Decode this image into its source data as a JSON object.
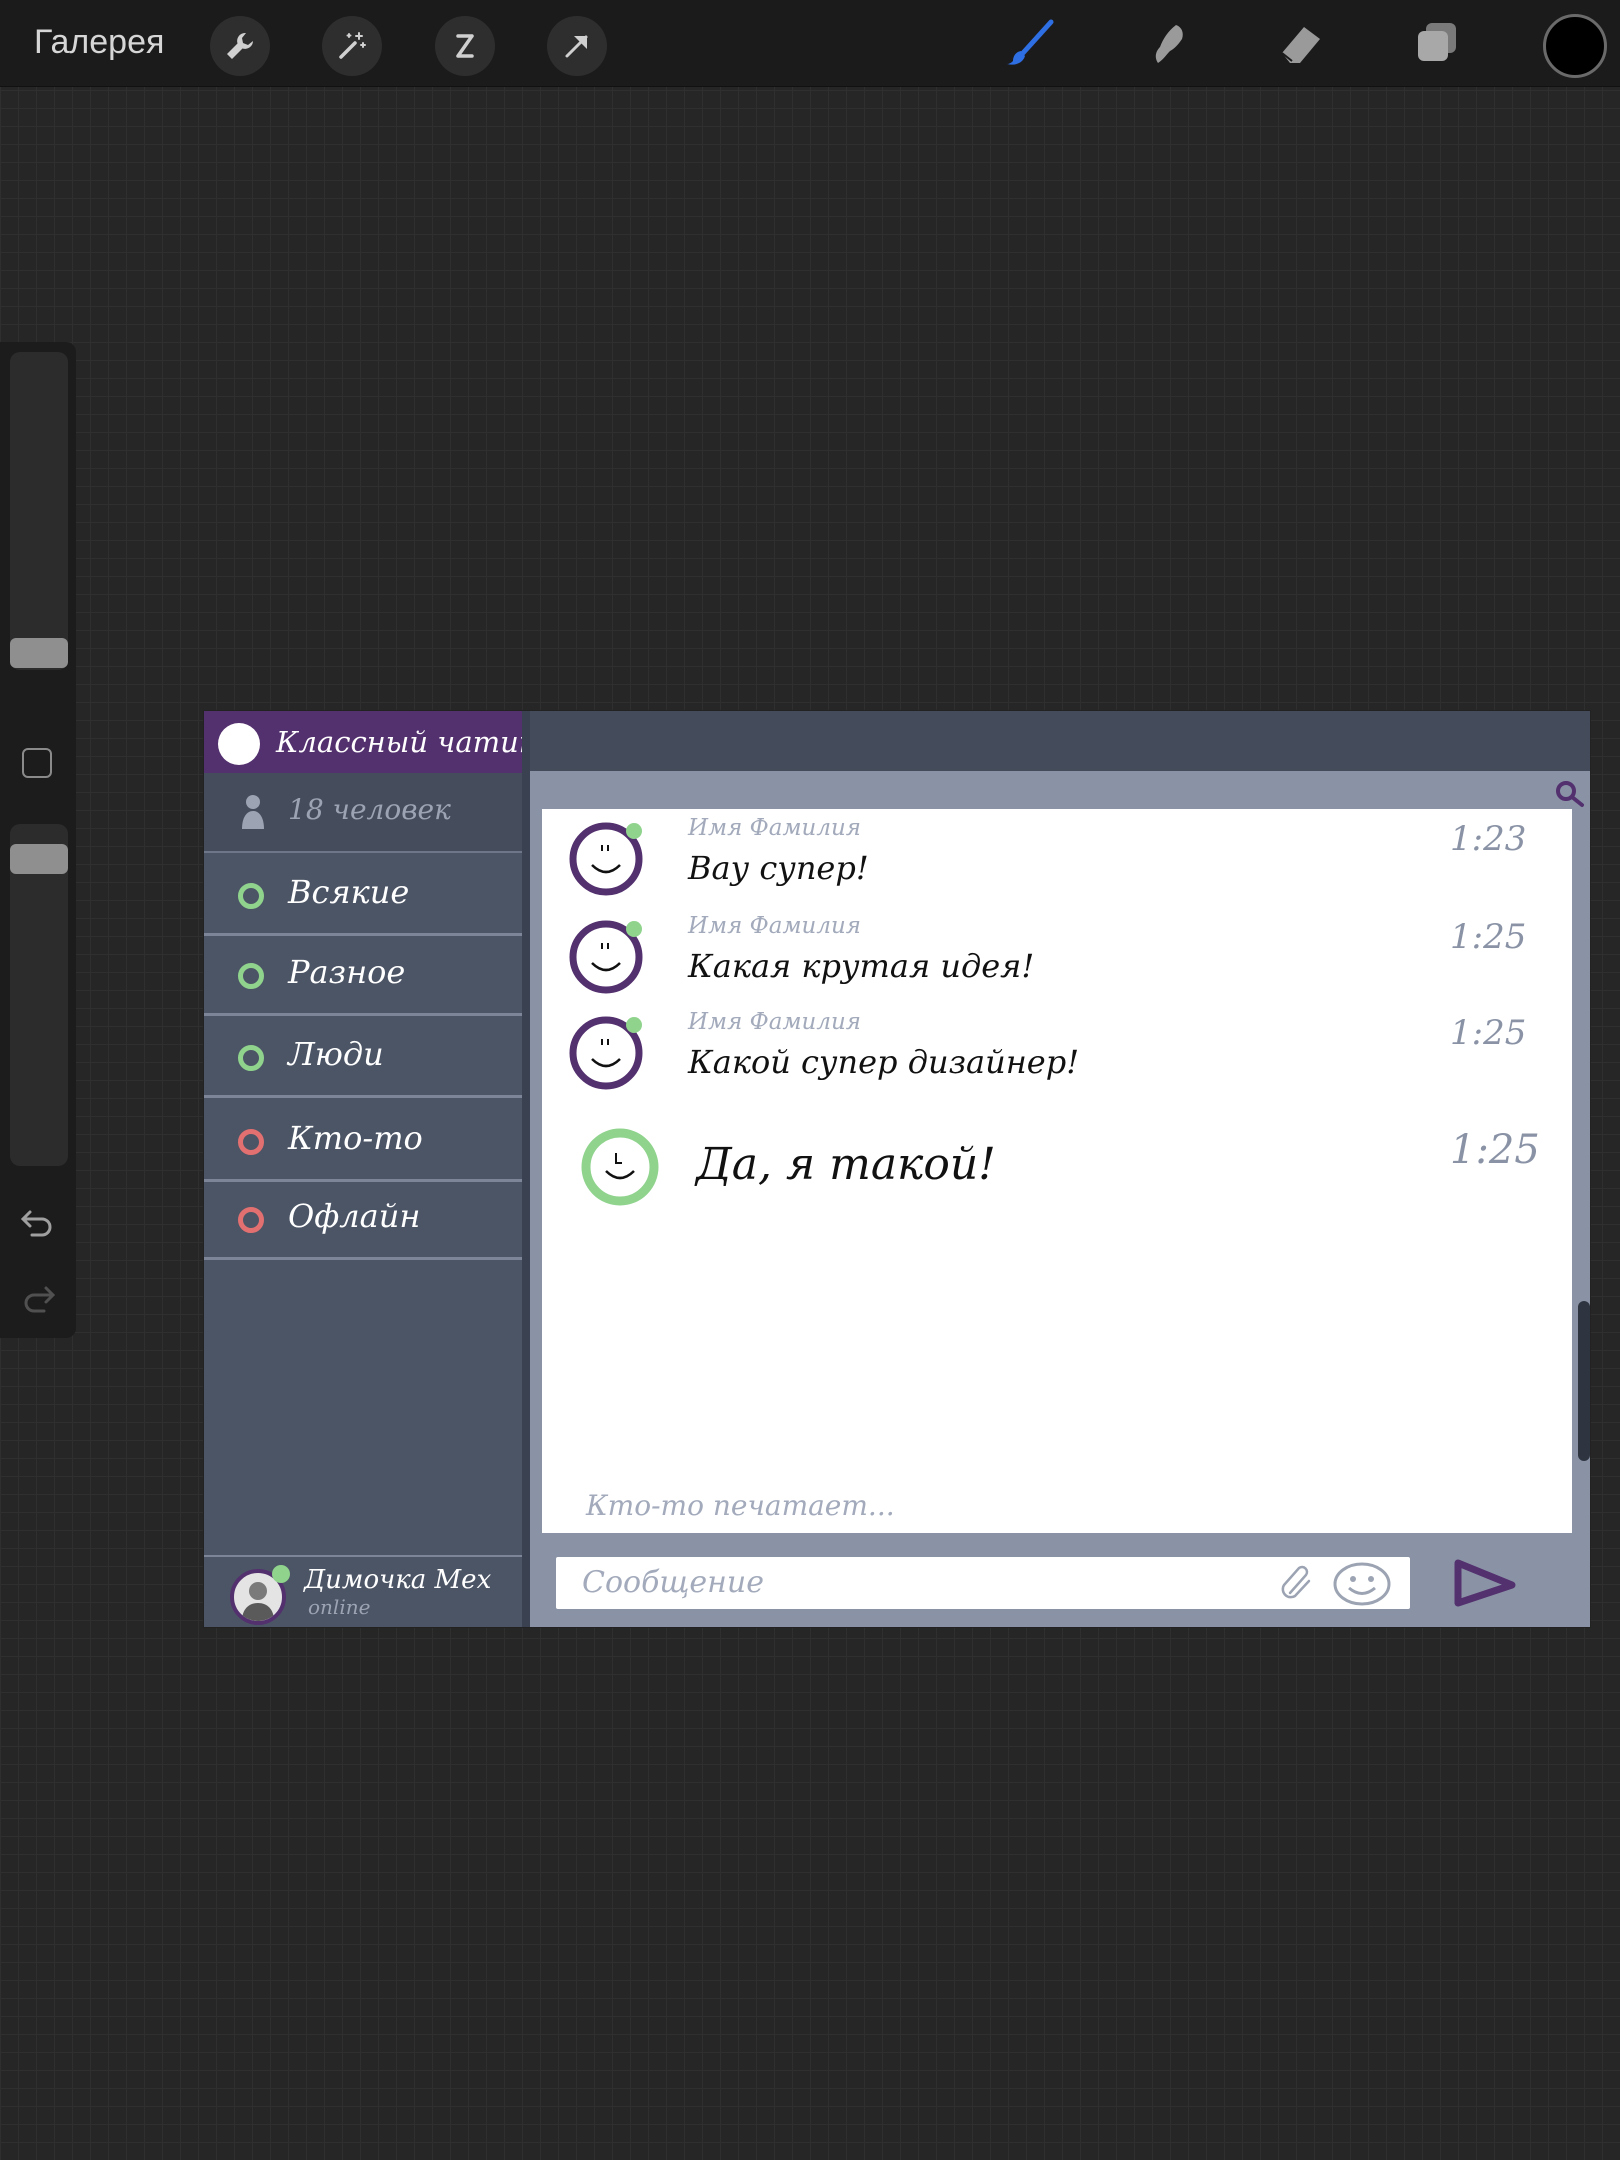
{
  "topbar": {
    "gallery_label": "Галерея",
    "left_tools": [
      "wrench-icon",
      "magic-wand-icon",
      "selection-icon",
      "transform-arrow-icon"
    ],
    "right_tools": [
      "brush-icon",
      "smudge-icon",
      "eraser-icon",
      "layers-icon"
    ],
    "active_tool": "brush-icon",
    "accent_color": "#2f6fe4",
    "current_color": "#000000"
  },
  "sidebar": {
    "brush_size_level": 0.05,
    "opacity_level": 0.92,
    "buttons": [
      "modify-icon",
      "undo-icon",
      "redo-icon"
    ]
  },
  "chat": {
    "title": "Классный чатик",
    "members_count": "18 человек",
    "channels": [
      {
        "label": "Всякие",
        "status": "online"
      },
      {
        "label": "Разное",
        "status": "online"
      },
      {
        "label": "Люди",
        "status": "online"
      },
      {
        "label": "Кто-то",
        "status": "offline"
      },
      {
        "label": "Офлайн",
        "status": "offline"
      }
    ],
    "status_colors": {
      "online": "#8fd38d",
      "offline": "#e27070"
    },
    "brand_color": "#53306e",
    "current_user": {
      "name": "Димочка Мех",
      "status": "online"
    },
    "messages": [
      {
        "name": "Имя Фамилия",
        "text": "Вау супер!",
        "time": "1:23",
        "own": false
      },
      {
        "name": "Имя Фамилия",
        "text": "Какая крутая идея!",
        "time": "1:25",
        "own": false
      },
      {
        "name": "Имя Фамилия",
        "text": "Какой супер дизайнер!",
        "time": "1:25",
        "own": false
      },
      {
        "name": "",
        "text": "Да, я такой!",
        "time": "1:25",
        "own": true
      }
    ],
    "typing_indicator": "Кто-то печатает...",
    "input_placeholder": "Сообщение"
  }
}
